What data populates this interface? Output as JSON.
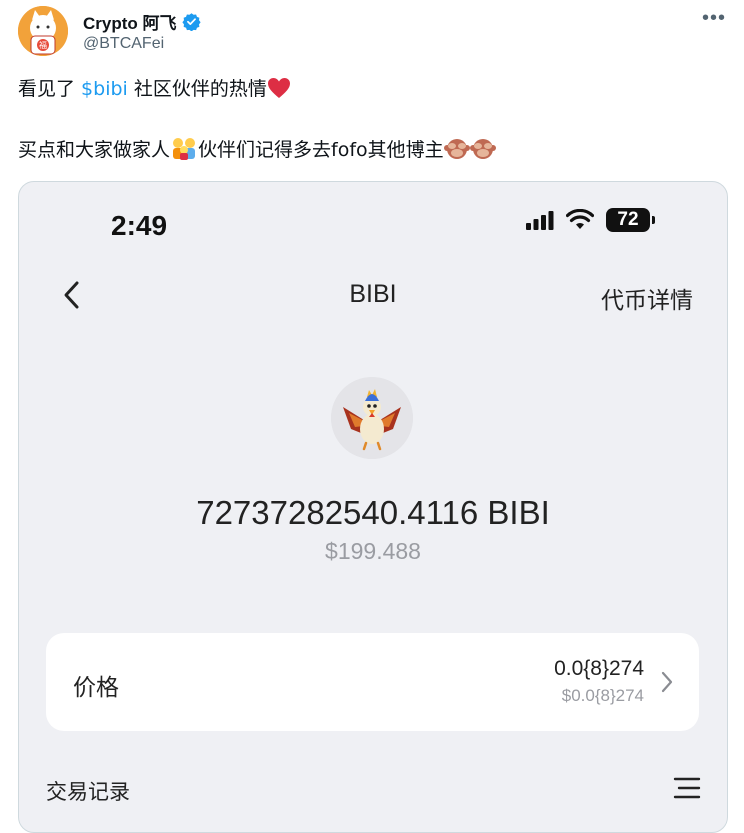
{
  "tweet": {
    "author_name": "Crypto 阿飞",
    "handle": "@BTCAFei",
    "line1_before": "看见了 ",
    "cashtag": "$bibi",
    "line1_after": " 社区伙伴的热情",
    "line2_a": "买点和大家做家人",
    "line2_b": "伙伴们记得多去fofo其他博主"
  },
  "screenshot": {
    "status_time": "2:49",
    "battery": "72",
    "nav_title": "BIBI",
    "nav_right": "代币详情",
    "balance": "72737282540.4116 BIBI",
    "fiat_value": "$199.488",
    "price_label": "价格",
    "price_value": "0.0{8}274",
    "price_sub": "$0.0{8}274",
    "section_title": "交易记录"
  },
  "icons": {
    "verified": "verified-badge-icon",
    "more": "more-options-icon",
    "heart": "red-heart-emoji",
    "family": "family-emoji",
    "monkey": "see-no-evil-monkey-emoji",
    "back": "back-chevron-icon",
    "chevron": "chevron-right-icon",
    "menu": "menu-lines-icon"
  },
  "colors": {
    "link": "#1d9bf0",
    "verified": "#1d9bf0",
    "card_bg": "#eff0f4",
    "muted": "#9a9ca2"
  }
}
